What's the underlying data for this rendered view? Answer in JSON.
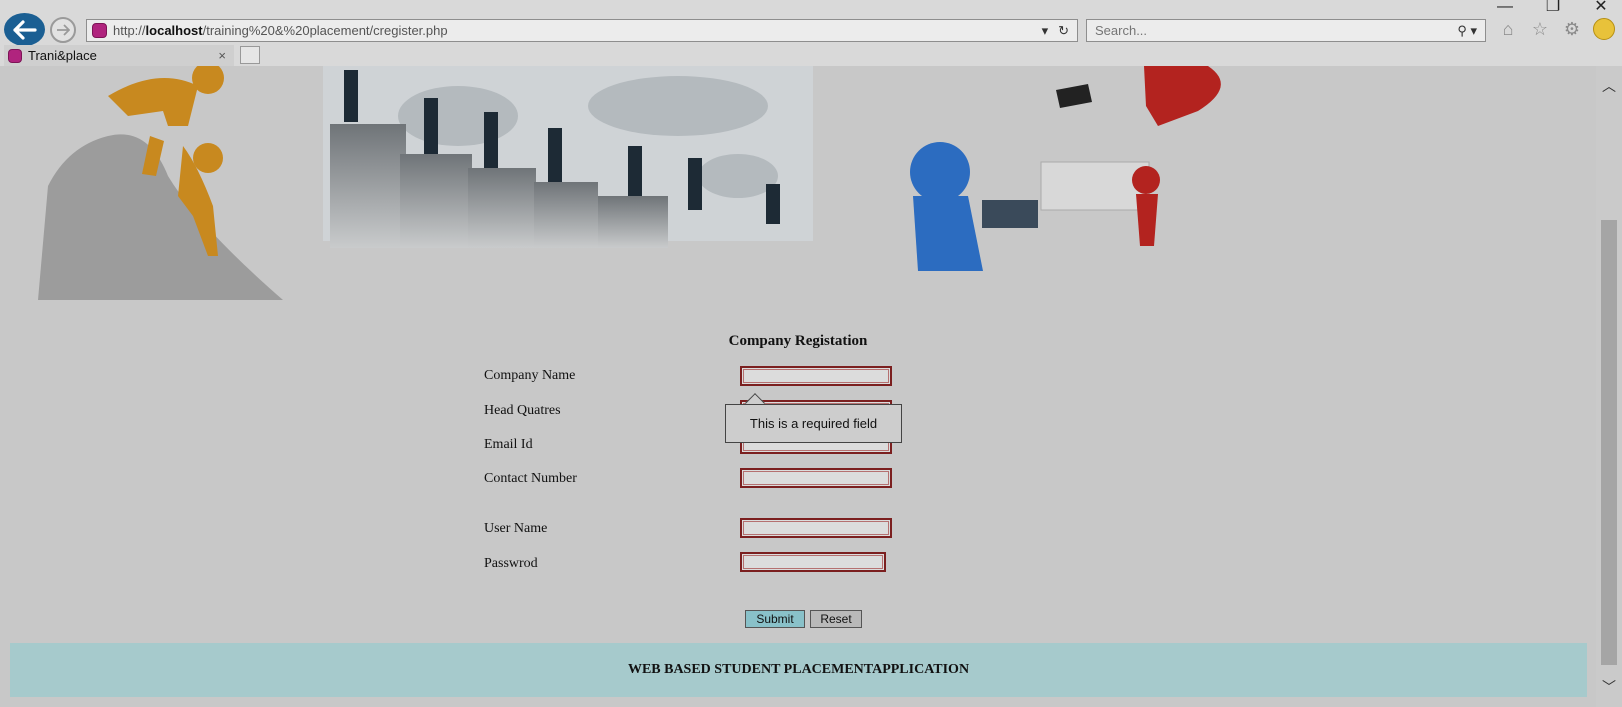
{
  "browser": {
    "url_prefix": "http://",
    "url_host": "localhost",
    "url_path": "/training%20&%20placement/cregister.php",
    "search_placeholder": "Search...",
    "tab_title": "Trani&place",
    "tab_close": "×"
  },
  "page": {
    "form_title": "Company Registation",
    "fields": [
      {
        "label": "Company Name"
      },
      {
        "label": "Head Quatres"
      },
      {
        "label": "Email Id"
      },
      {
        "label": "Contact Number"
      },
      {
        "label": "User Name"
      },
      {
        "label": "Passwrod"
      }
    ],
    "tooltip": "This is a required field",
    "submit_label": "Submit",
    "reset_label": "Reset",
    "footer": "WEB BASED STUDENT PLACEMENTAPPLICATION"
  },
  "colors": {
    "back_button": "#1b5f93",
    "input_border": "#7b1f1f",
    "submit_bg": "#89c1c9",
    "footer_bg": "#a6cacc"
  }
}
